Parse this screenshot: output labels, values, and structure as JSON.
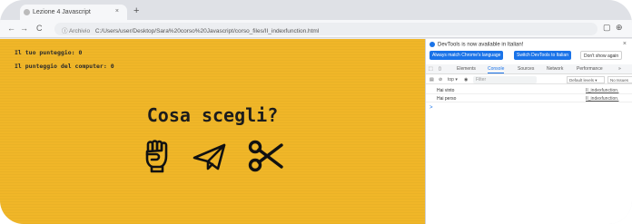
{
  "browser": {
    "tab_title": "Lezione 4 Javascript",
    "tab_close": "×",
    "new_tab": "+",
    "nav_back": "←",
    "nav_forward": "→",
    "nav_reload": "C",
    "address_prefix": "ⓘ Archivio",
    "address": "C:/Users/user/Desktop/Sara%20corso%20Javascript/corso_files/II_indexfunction.html",
    "toolbar_right_1": "▢",
    "toolbar_right_2": "⊕"
  },
  "page": {
    "background": "#f0b628",
    "player_score_label": "Il tuo punteggio:",
    "player_score": "0",
    "computer_score_label": "Il punteggio del computer:",
    "computer_score": "0",
    "question": "Cosa scegli?",
    "choices": [
      "fist-icon",
      "paper-plane-icon",
      "scissors-icon"
    ]
  },
  "devtools": {
    "notice": "DevTools is now available in Italian!",
    "notice_close": "×",
    "btn_always_match": "Always match Chrome's language",
    "btn_switch": "Switch DevTools to Italian",
    "btn_dont_show": "Don't show again",
    "tabs": [
      "Elements",
      "Console",
      "Sources",
      "Network",
      "Performance"
    ],
    "active_tab": "Console",
    "filter_context": "top ▾",
    "filter_placeholder": "Filter",
    "levels": "Default levels ▾",
    "issues": "No Issues",
    "logs": [
      {
        "message": "Hai vinto",
        "source": "II_indexfunction."
      },
      {
        "message": "Hai perso",
        "source": "II_indexfunction."
      }
    ],
    "prompt": ">"
  }
}
